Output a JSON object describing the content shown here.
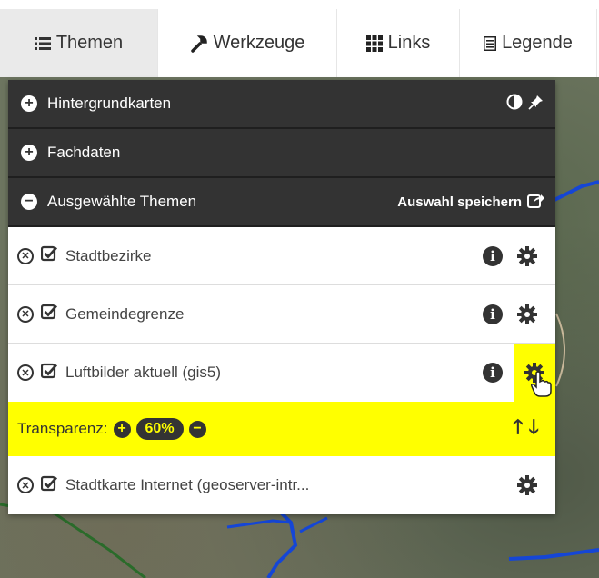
{
  "tabs": [
    {
      "label": "Themen",
      "icon": "list-icon",
      "active": true
    },
    {
      "label": "Werkzeuge",
      "icon": "wrench-icon",
      "active": false
    },
    {
      "label": "Links",
      "icon": "grid-icon",
      "active": false
    },
    {
      "label": "Legende",
      "icon": "legend-icon",
      "active": false
    }
  ],
  "sections": {
    "background": {
      "label": "Hintergrundkarten",
      "toggle": "+"
    },
    "specialist": {
      "label": "Fachdaten",
      "toggle": "+"
    },
    "selected": {
      "label": "Ausgewählte Themen",
      "toggle": "−",
      "save_label": "Auswahl speichern"
    }
  },
  "layers": [
    {
      "name": "Stadtbezirke",
      "has_info": true
    },
    {
      "name": "Gemeindegrenze",
      "has_info": true
    },
    {
      "name": "Luftbilder aktuell (gis5)",
      "has_info": true
    },
    {
      "name": "Stadtkarte Internet (geoserver-intr...",
      "has_info": false
    }
  ],
  "transparency": {
    "label": "Transparenz:",
    "value": "60%"
  },
  "colors": {
    "highlight": "#ffff00",
    "dark": "#333333",
    "road": "#1546d6"
  }
}
